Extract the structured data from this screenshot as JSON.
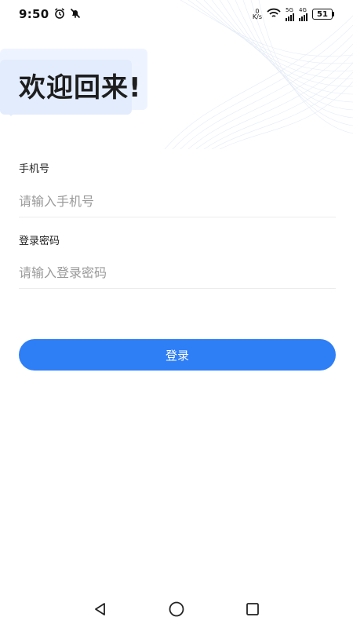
{
  "status_bar": {
    "time": "9:50",
    "net_speed_value": "0",
    "net_speed_unit": "K/s",
    "signal1_label": "5G",
    "signal2_label": "4G",
    "battery_level": "51"
  },
  "page": {
    "title": "欢迎回来!"
  },
  "form": {
    "phone_label": "手机号",
    "phone_placeholder": "请输入手机号",
    "password_label": "登录密码",
    "password_placeholder": "请输入登录密码",
    "login_button": "登录"
  },
  "nav": {
    "back": "back-icon",
    "home": "home-icon",
    "recents": "recents-icon"
  },
  "colors": {
    "accent": "#2e7ef6",
    "bubble": "#e2ecfd",
    "placeholder": "#9a9a9a"
  }
}
